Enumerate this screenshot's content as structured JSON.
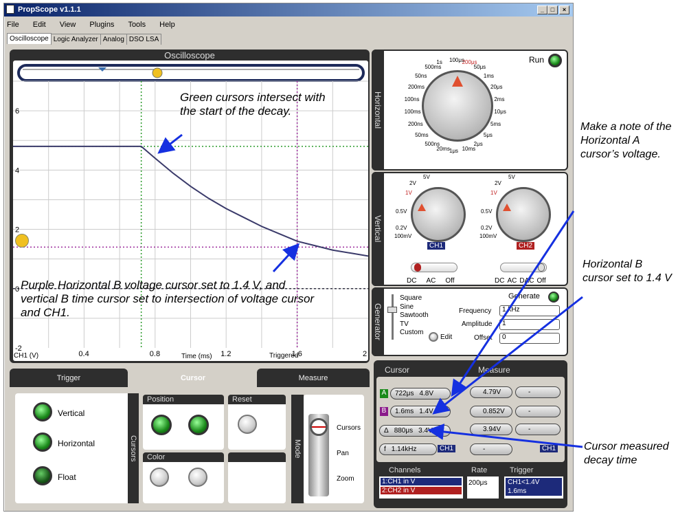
{
  "window": {
    "title": "PropScope v1.1.1",
    "min": "_",
    "max": "□",
    "close": "×"
  },
  "menu": [
    "File",
    "Edit",
    "View",
    "Plugins",
    "Tools",
    "Help"
  ],
  "tabs": [
    "Oscilloscope",
    "Logic Analyzer",
    "Analog",
    "DSO LSA"
  ],
  "scope": {
    "title": "Oscilloscope",
    "y_ticks": [
      "6",
      "4",
      "2",
      "0",
      "-2"
    ],
    "x_ticks": [
      "0.4",
      "0.8",
      "1.2",
      "1.6",
      "2"
    ],
    "channel_label": "CH1 (V)",
    "xlabel": "Time (ms)",
    "status": "Triggered"
  },
  "chart_data": {
    "type": "line",
    "title": "Oscilloscope",
    "xlabel": "Time (ms)",
    "ylabel": "CH1 (V)",
    "xlim": [
      0,
      2
    ],
    "ylim": [
      -2,
      7
    ],
    "series": [
      {
        "name": "CH1",
        "x": [
          0,
          0.2,
          0.4,
          0.6,
          0.722,
          0.8,
          0.9,
          1.0,
          1.1,
          1.2,
          1.3,
          1.4,
          1.5,
          1.6,
          1.7,
          1.8,
          1.9,
          2.0
        ],
        "y": [
          4.8,
          4.8,
          4.8,
          4.8,
          4.8,
          4.4,
          3.9,
          3.45,
          3.05,
          2.7,
          2.4,
          2.1,
          1.85,
          1.6,
          1.45,
          1.3,
          1.2,
          1.1
        ]
      }
    ],
    "cursors": {
      "vertical_A_ms": 0.722,
      "vertical_B_ms": 1.6,
      "horizontal_A_V": 4.8,
      "horizontal_B_V": 1.4
    },
    "grid": true
  },
  "horizontal": {
    "label": "Horizontal",
    "run": "Run",
    "ticks": [
      "100μs",
      "200μs",
      "50μs",
      "1ms",
      "20μs",
      "2ms",
      "10μs",
      "5ms",
      "5μs",
      "2μs",
      "10ms",
      "1μs",
      "20ms",
      "500ns",
      "50ms",
      "200ns",
      "100ms",
      "100ns",
      "200ms",
      "50ns",
      "500ms",
      "1s"
    ]
  },
  "vertical": {
    "label": "Vertical",
    "ch1_ticks": [
      "5V",
      "2V",
      "1V",
      "0.5V",
      "0.2V",
      "100mV"
    ],
    "ch2_ticks": [
      "5V",
      "2V",
      "1V",
      "0.5V",
      "0.2V",
      "100mV"
    ],
    "ch1": "CH1",
    "ch2": "CH2",
    "coupling1": [
      "DC",
      "AC",
      "Off"
    ],
    "coupling2": [
      "DC",
      "AC",
      "DAC",
      "Off"
    ]
  },
  "generator": {
    "label": "Generator",
    "waves": [
      "Square",
      "Sine",
      "Sawtooth",
      "TV",
      "Custom"
    ],
    "edit": "Edit",
    "generate": "Generate",
    "frequency_label": "Frequency",
    "frequency": "1 kHz",
    "amplitude_label": "Amplitude",
    "amplitude": "1",
    "offset_label": "Offset",
    "offset": "0"
  },
  "bottom_tabs": {
    "trigger": "Trigger",
    "cursor": "Cursor",
    "measure": "Measure"
  },
  "cursor_panel": {
    "vertical": "Vertical",
    "horizontal": "Horizontal",
    "float": "Float",
    "cursors_vlabel": "Cursors",
    "position": "Position",
    "reset": "Reset",
    "color": "Color",
    "mode": "Mode",
    "modes": [
      "Cursors",
      "Pan",
      "Zoom"
    ]
  },
  "readouts": {
    "cursor_title": "Cursor",
    "measure_title": "Measure",
    "a_label": "A",
    "a_time": "722μs",
    "a_volt": "4.8V",
    "b_label": "B",
    "b_time": "1.6ms",
    "b_volt": "1.4V",
    "delta_label": "Δ",
    "delta_time": "880μs",
    "delta_volt": "3.4V",
    "f_label": "f",
    "f_value": "1.14kHz",
    "f_ch": "CH1",
    "m1": "4.79V",
    "m2": "-",
    "m3": "0.852V",
    "m4": "-",
    "m5": "3.94V",
    "m6": "-",
    "m7": "-",
    "m_ch": "CH1",
    "channels_title": "Channels",
    "ch1_line": "1:CH1 in V",
    "ch2_line": "2:CH2 in V",
    "rate_title": "Rate",
    "rate": "200μs",
    "trigger_title": "Trigger",
    "trigger_cond": "CH1<1.4V",
    "trigger_time": "1.6ms"
  },
  "annotations": {
    "green": "Green cursors intersect with the start of the decay.",
    "purple": "Purple Horizontal B voltage cursor set to 1.4 V, and vertical B time cursor set to intersection of voltage cursor and CH1.",
    "note": "Make a note of the Horizontal A cursor’s voltage.",
    "hb": "Horizontal B cursor set to 1.4 V",
    "cm": "Cursor measured decay time"
  }
}
